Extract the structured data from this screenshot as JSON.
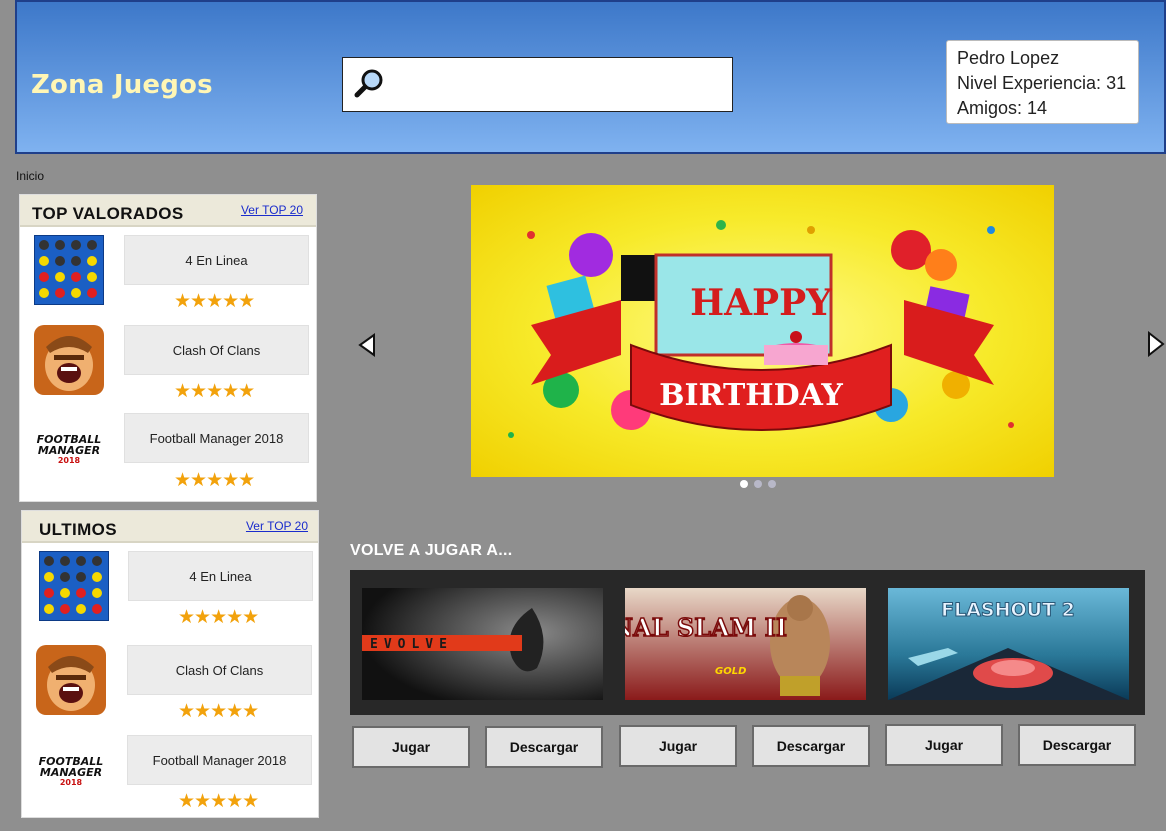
{
  "app": {
    "logo": "Zona Juegos"
  },
  "search": {
    "placeholder": ""
  },
  "user": {
    "name": "Pedro Lopez",
    "level": "Nivel Experiencia: 31",
    "friends": "Amigos: 14"
  },
  "breadcrumb": "Inicio",
  "top_rated": {
    "title": "TOP VALORADOS",
    "link": "Ver TOP 20",
    "games": [
      {
        "name": "4 En Linea",
        "stars": "★★★★★",
        "icon": "connect-four-icon"
      },
      {
        "name": "Clash Of Clans",
        "stars": "★★★★★",
        "icon": "clash-of-clans-icon"
      },
      {
        "name": "Football Manager 2018",
        "stars": "★★★★★",
        "icon": "football-manager-logo"
      }
    ]
  },
  "latest": {
    "title": "ULTIMOS",
    "link": "Ver TOP 20",
    "games": [
      {
        "name": "4 En Linea",
        "stars": "★★★★★",
        "icon": "connect-four-icon"
      },
      {
        "name": "Clash Of Clans",
        "stars": "★★★★★",
        "icon": "clash-of-clans-icon"
      },
      {
        "name": "Football Manager 2018",
        "stars": "★★★★★",
        "icon": "football-manager-logo"
      }
    ]
  },
  "banner": {
    "line1": "HAPPY",
    "line2": "BIRTHDAY",
    "dots": 3,
    "active_dot": 0
  },
  "play_again": {
    "title": "VOLVE A JUGAR A...",
    "games": [
      {
        "title": "EVOLVE",
        "play": "Jugar",
        "download": "Descargar"
      },
      {
        "title": "FINAL SLAM II",
        "badge": "GOLD",
        "play": "Jugar",
        "download": "Descargar"
      },
      {
        "title": "FLASHOUT 2",
        "play": "Jugar",
        "download": "Descargar"
      }
    ]
  },
  "colors": {
    "header_top": "#3d78c9",
    "header_bottom": "#7fb2f0",
    "logo": "#fff6b5",
    "stars": "#f2a20c",
    "background": "#8f8f8f"
  }
}
